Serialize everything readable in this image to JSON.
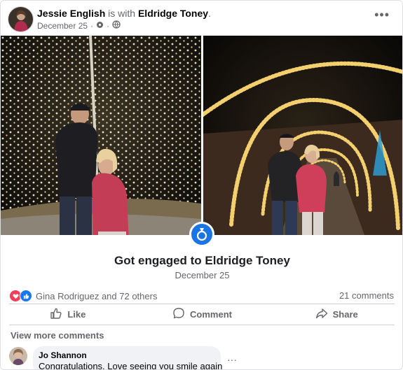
{
  "post": {
    "author": "Jessie English",
    "with_text": "is with",
    "tagged": "Eldridge Toney",
    "period": ".",
    "date": "December 25",
    "separator": "·",
    "more_label": "•••"
  },
  "life_event": {
    "title": "Got engaged to Eldridge Toney",
    "date": "December 25"
  },
  "reactions": {
    "summary": "Gina Rodriguez and 72 others",
    "comments": "21 comments",
    "love_color": "#f33e58",
    "like_color": "#1877f2"
  },
  "actions": {
    "like": "Like",
    "comment": "Comment",
    "share": "Share"
  },
  "comments": {
    "view_more": "View more comments",
    "items": [
      {
        "author": "Jo Shannon",
        "text": "Congratulations. Love seeing you smile again"
      }
    ],
    "more_label": "···"
  },
  "icons": {
    "header_more": "more-dots-icon",
    "privacy": "globe-icon",
    "life_event": "ring-icon",
    "like": "thumbs-up-icon",
    "comment": "comment-bubble-icon",
    "share": "share-arrow-icon"
  },
  "accent_color": "#1b74e4"
}
